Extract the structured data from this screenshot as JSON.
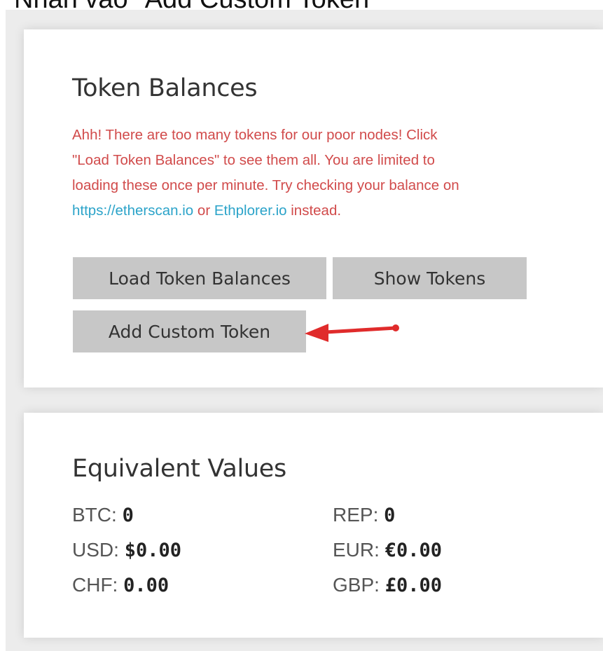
{
  "caption": "Nhấn vào \"Add Custom Token\"",
  "token_balances": {
    "title": "Token Balances",
    "warning": {
      "line1": "Ahh! There are too many tokens for our poor nodes! Click",
      "line2": "\"Load Token Balances\" to see them all. You are limited to",
      "line3": "loading these once per minute. Try checking your balance on",
      "link1": "https://etherscan.io",
      "or_text": " or ",
      "link2": "Ethplorer.io",
      "tail": " instead."
    },
    "buttons": {
      "load": "Load Token Balances",
      "show": "Show Tokens",
      "add": "Add Custom Token"
    }
  },
  "equivalent_values": {
    "title": "Equivalent Values",
    "rows": [
      {
        "left": {
          "label": "BTC: ",
          "value": "0"
        },
        "right": {
          "label": "REP: ",
          "value": "0"
        }
      },
      {
        "left": {
          "label": "USD: ",
          "value": "$0.00"
        },
        "right": {
          "label": "EUR: ",
          "value": "€0.00"
        }
      },
      {
        "left": {
          "label": "CHF: ",
          "value": "0.00"
        },
        "right": {
          "label": "GBP: ",
          "value": "£0.00"
        }
      }
    ]
  },
  "colors": {
    "warning_text": "#d14b4b",
    "link": "#2ba3c9",
    "button_bg": "#c7c7c7",
    "arrow": "#e02b2b"
  },
  "icons": {
    "annotation": "red-arrow-icon"
  }
}
